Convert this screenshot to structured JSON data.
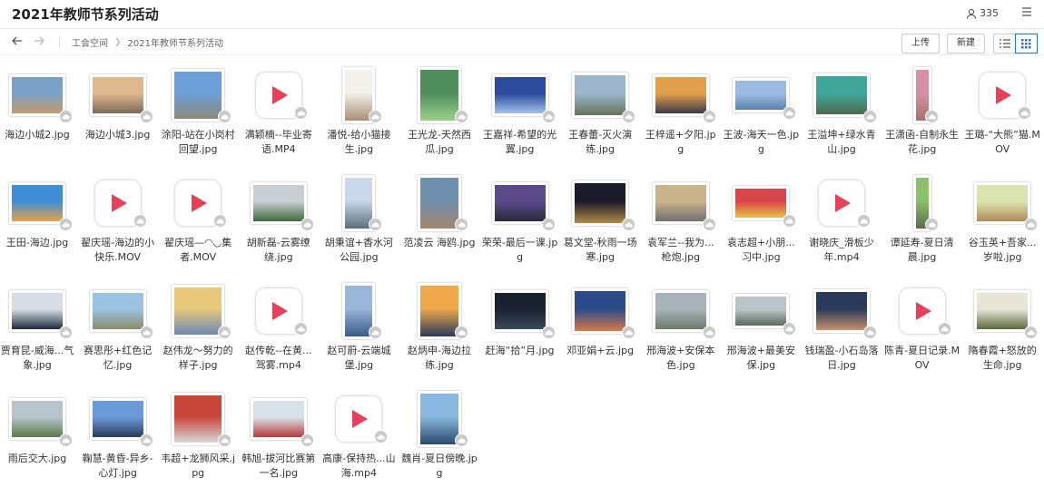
{
  "app": {
    "title": "2021年教师节系列活动",
    "member_count": "335"
  },
  "breadcrumb": [
    "工会空间",
    "2021年教师节系列活动"
  ],
  "toolbar": {
    "upload_label": "上传",
    "new_label": "新建"
  },
  "colors": {
    "accent": "#1f74e0",
    "play": "#e8405a"
  },
  "files": [
    {
      "name": "海边小城2.jpg",
      "type": "image",
      "tone": [
        "#7ca1c9",
        "#c59a6b"
      ]
    },
    {
      "name": "海边小城3.jpg",
      "type": "image",
      "tone": [
        "#e0b890",
        "#7d6a58"
      ]
    },
    {
      "name": "涂阳-站在小岗村回望.jpg",
      "type": "image",
      "tone": [
        "#6d9fd8",
        "#8a8a7a"
      ]
    },
    {
      "name": "满颖楠--毕业寄语.MP4",
      "type": "video"
    },
    {
      "name": "潘悦-给小猫接生.jpg",
      "type": "image",
      "tone": [
        "#f4f0ea",
        "#a88f76"
      ]
    },
    {
      "name": "王光龙-天然西瓜.jpg",
      "type": "image",
      "tone": [
        "#4f8d5c",
        "#9ccf8a"
      ]
    },
    {
      "name": "王嘉祥-希望的光翼.jpg",
      "type": "image",
      "tone": [
        "#2b4b9c",
        "#9fc2e8"
      ]
    },
    {
      "name": "王春蕾-灭火演练.jpg",
      "type": "image",
      "tone": [
        "#9cb6cc",
        "#66745a"
      ]
    },
    {
      "name": "王梓遥+夕阳.jpg",
      "type": "image",
      "tone": [
        "#e3a04b",
        "#3a3a4a"
      ]
    },
    {
      "name": "王波-海天一色.jpg",
      "type": "image",
      "tone": [
        "#9dbbe2",
        "#5a7fa8"
      ]
    },
    {
      "name": "王溢坤+绿水青山.jpg",
      "type": "image",
      "tone": [
        "#3fa79a",
        "#4c6a4c"
      ]
    },
    {
      "name": "王潇函-自制永生花.jpg",
      "type": "image",
      "tone": [
        "#d98fa5",
        "#a3736a"
      ]
    },
    {
      "name": "王璐-“大熊”猫.MOV",
      "type": "video"
    },
    {
      "name": "王田-海边.jpg",
      "type": "image",
      "tone": [
        "#3f8ed6",
        "#e7a24a"
      ]
    },
    {
      "name": "翟庆瑶-海边的小快乐.MOV",
      "type": "video"
    },
    {
      "name": "翟庆瑶—◠◡集者.MOV",
      "type": "video"
    },
    {
      "name": "胡新磊-云雾缭绕.jpg",
      "type": "image",
      "tone": [
        "#c7cfd3",
        "#3f6a3a"
      ]
    },
    {
      "name": "胡秉谊+香水河公园.jpg",
      "type": "image",
      "tone": [
        "#c9d8ea",
        "#5a6f7a"
      ]
    },
    {
      "name": "范凌云 海鸥.jpg",
      "type": "image",
      "tone": [
        "#6f8fae",
        "#a4866c"
      ]
    },
    {
      "name": "荣荣-最后一课.jpg",
      "type": "image",
      "tone": [
        "#5a4a8a",
        "#2a2a3a"
      ]
    },
    {
      "name": "葛文堂-秋雨一场寒.jpg",
      "type": "image",
      "tone": [
        "#1b1a2a",
        "#b08a4a"
      ]
    },
    {
      "name": "袁军兰--我为...枪炮.jpg",
      "type": "image",
      "tone": [
        "#c9b38a",
        "#707070"
      ]
    },
    {
      "name": "袁志超+小朋...习中.jpg",
      "type": "image",
      "tone": [
        "#d8454a",
        "#e8c24a"
      ]
    },
    {
      "name": "谢晓庆_滑板少年.mp4",
      "type": "video"
    },
    {
      "name": "谭延寿-夏日清晨.jpg",
      "type": "image",
      "tone": [
        "#8cc06a",
        "#5a6a4a"
      ]
    },
    {
      "name": "谷玉英+吾家...岁啦.jpg",
      "type": "image",
      "tone": [
        "#d9e4b0",
        "#b08a5a"
      ]
    },
    {
      "name": "贾育昆-威海...气象.jpg",
      "type": "image",
      "tone": [
        "#d8dde5",
        "#1c2a3a"
      ]
    },
    {
      "name": "赛思彤+红色记忆.jpg",
      "type": "image",
      "tone": [
        "#9bc3e2",
        "#8a8a6a"
      ]
    },
    {
      "name": "赵伟龙～努力的样子.jpg",
      "type": "image",
      "tone": [
        "#e8c87a",
        "#6a8ab8"
      ]
    },
    {
      "name": "赵传乾--在黄...驾雾.mp4",
      "type": "video"
    },
    {
      "name": "赵可蔚-云端城堡.jpg",
      "type": "image",
      "tone": [
        "#9ab6d8",
        "#3a5a8a"
      ]
    },
    {
      "name": "赵炳申-海边拉练.jpg",
      "type": "image",
      "tone": [
        "#f0a84a",
        "#2a3a5a"
      ]
    },
    {
      "name": "赶海“拾”月.jpg",
      "type": "image",
      "tone": [
        "#1a2230",
        "#3a4a5a"
      ]
    },
    {
      "name": "邓亚娟+云.jpg",
      "type": "image",
      "tone": [
        "#2a4a8a",
        "#d87a4a"
      ]
    },
    {
      "name": "邢海波+安保本色.jpg",
      "type": "image",
      "tone": [
        "#a8b4ba",
        "#6a7a6a"
      ]
    },
    {
      "name": "邢海波+最美安保.jpg",
      "type": "image",
      "tone": [
        "#b8c4c6",
        "#5a6a5a"
      ]
    },
    {
      "name": "钱瑞盈-小石岛落日.jpg",
      "type": "image",
      "tone": [
        "#2a3a5a",
        "#c8906a"
      ]
    },
    {
      "name": "陈青-夏日记录.MOV",
      "type": "video"
    },
    {
      "name": "隋春霞+怒放的生命.jpg",
      "type": "image",
      "tone": [
        "#e8e4d8",
        "#5a6a3a"
      ]
    },
    {
      "name": "雨后交大.jpg",
      "type": "image",
      "tone": [
        "#b8c4cc",
        "#5a7a4a"
      ]
    },
    {
      "name": "鞠慧-黄昏-异乡-心灯.jpg",
      "type": "image",
      "tone": [
        "#6a9ad8",
        "#2a3a5a"
      ]
    },
    {
      "name": "韦超+龙狮风采.jpg",
      "type": "image",
      "tone": [
        "#c8453a",
        "#d8d8d8"
      ]
    },
    {
      "name": "韩旭-拔河比赛第一名.jpg",
      "type": "image",
      "tone": [
        "#d8e2ea",
        "#b83a3a"
      ]
    },
    {
      "name": "高康-保持热...山海.mp4",
      "type": "video"
    },
    {
      "name": "魏肖-夏日傍晚.jpg",
      "type": "image",
      "tone": [
        "#8ab8e0",
        "#2a4a6a"
      ]
    }
  ]
}
